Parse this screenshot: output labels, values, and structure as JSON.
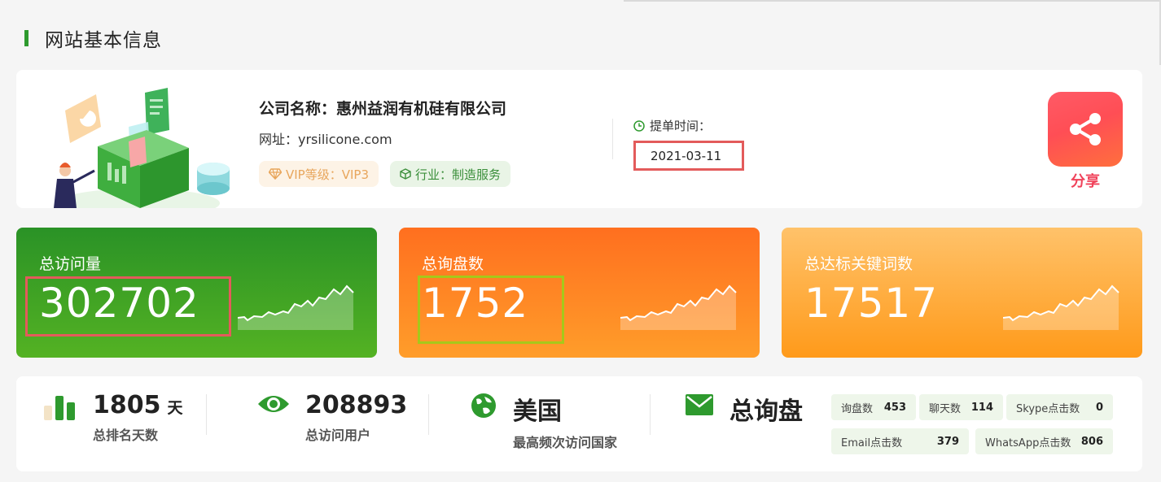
{
  "section_title": "网站基本信息",
  "company": {
    "name": "公司名称：惠州益润有机硅有限公司",
    "url": "网址：yrsilicone.com",
    "vip_tag": "VIP等级：VIP3",
    "industry_tag": "行业：制造服务"
  },
  "order": {
    "label": "提单时间：",
    "date": "2021-03-11"
  },
  "share": {
    "label": "分享"
  },
  "stats": [
    {
      "label": "总访问量",
      "value": "302702"
    },
    {
      "label": "总询盘数",
      "value": "1752"
    },
    {
      "label": "总达标关键词数",
      "value": "17517"
    }
  ],
  "metrics": [
    {
      "value": "1805",
      "unit": "天",
      "desc": "总排名天数"
    },
    {
      "value": "208893",
      "desc": "总访问用户"
    },
    {
      "value": "美国",
      "desc": "最高频次访问国家"
    },
    {
      "value": "总询盘"
    }
  ],
  "chips": [
    {
      "label": "询盘数",
      "value": "453"
    },
    {
      "label": "聊天数",
      "value": "114"
    },
    {
      "label": "Skype点击数",
      "value": "0"
    },
    {
      "label": "Email点击数",
      "value": "379"
    },
    {
      "label": "WhatsApp点击数",
      "value": "806"
    }
  ],
  "colors": {
    "brand_green": "#2e9a2e",
    "highlight_red": "#e35b5b",
    "highlight_lime": "#a6c81a",
    "share_pink": "#f0425a"
  }
}
